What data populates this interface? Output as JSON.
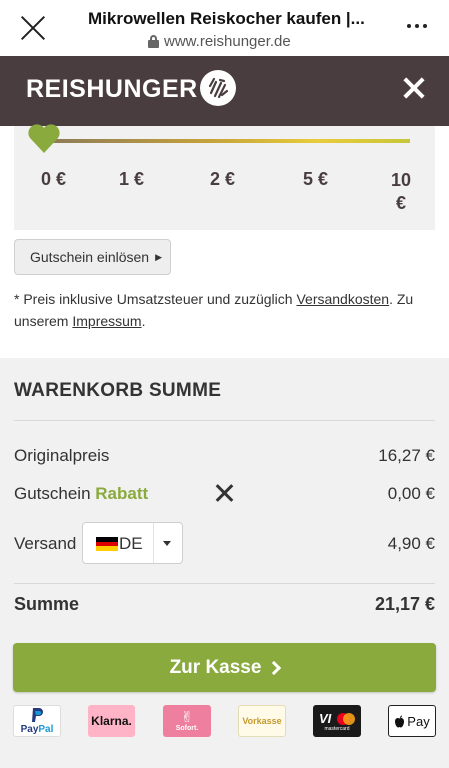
{
  "browser": {
    "title": "Mikrowellen Reiskocher kaufen |...",
    "url": "www.reishunger.de"
  },
  "header": {
    "logo_text": "REISHUNGER"
  },
  "donation_slider": {
    "labels": [
      "0 €",
      "1 €",
      "2 €",
      "5 €",
      "10 €"
    ],
    "selected_value": 0,
    "colors": {
      "thumb": "#8aaa3e"
    }
  },
  "voucher": {
    "button_label": "Gutschein einlösen"
  },
  "note": {
    "text_before": "* Preis inklusive Umsatzsteuer und zuzüglich ",
    "shipping_link": "Versandkosten",
    "text_middle": ". Zu unserem ",
    "imprint_link": "Impressum",
    "text_after": "."
  },
  "cart": {
    "title": "WARENKORB SUMME",
    "original_price_label": "Originalpreis",
    "original_price_value": "16,27 €",
    "voucher_label": "Gutschein",
    "voucher_code": "Rabatt",
    "voucher_value": "0,00 €",
    "shipping_label": "Versand",
    "shipping_country": "DE",
    "shipping_value": "4,90 €",
    "sum_label": "Summe",
    "sum_value": "21,17 €",
    "checkout_label": "Zur Kasse"
  },
  "payments": {
    "paypal_a": "Pay",
    "paypal_b": "Pal",
    "klarna": "Klarna.",
    "sofort": "Sofort.",
    "vorkasse": "Vorkasse",
    "card": "mastercard",
    "applepay": "Pay"
  },
  "colors": {
    "header_bg": "#4a3d3f",
    "accent_green": "#8aaa3e",
    "panel_bg": "#f1f1f1"
  }
}
